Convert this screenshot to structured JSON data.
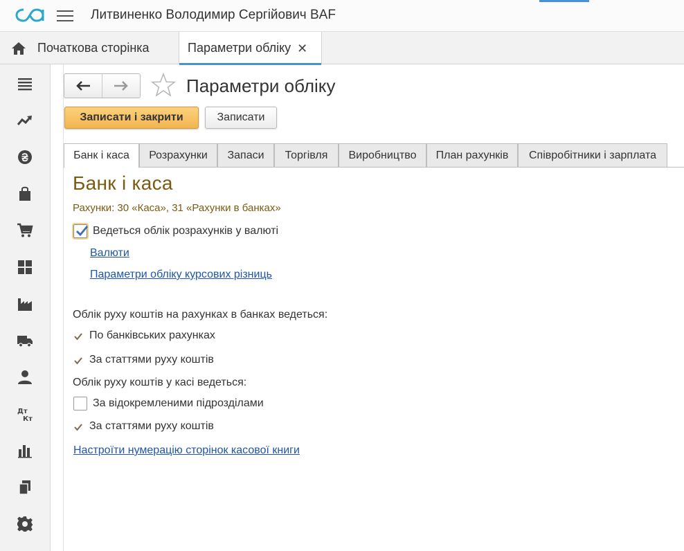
{
  "header": {
    "app_title": "Литвиненко Володимир Сергійович BAF",
    "logo_icon": "baf-logo-icon",
    "menu_icon": "hamburger-icon",
    "accent_color": "#4a90d9"
  },
  "tabs": {
    "home_label": "Початкова сторінка",
    "active_label": "Параметри обліку",
    "close_glyph": "✕"
  },
  "sidebar": {
    "items": [
      {
        "name": "main-menu",
        "icon": "list-icon"
      },
      {
        "name": "sales-dashboard",
        "icon": "trend-icon"
      },
      {
        "name": "bank-cash",
        "icon": "hryvnia-coin-icon"
      },
      {
        "name": "purchases",
        "icon": "shopping-bag-icon"
      },
      {
        "name": "sales",
        "icon": "cart-icon"
      },
      {
        "name": "warehouse",
        "icon": "boxes-icon"
      },
      {
        "name": "production",
        "icon": "factory-icon"
      },
      {
        "name": "fixed-assets",
        "icon": "truck-icon"
      },
      {
        "name": "hr-salary",
        "icon": "person-icon"
      },
      {
        "name": "accounting",
        "icon": "debit-credit-icon"
      },
      {
        "name": "reports",
        "icon": "bar-chart-icon"
      },
      {
        "name": "reference-books",
        "icon": "documents-icon"
      },
      {
        "name": "administration",
        "icon": "gear-icon"
      }
    ]
  },
  "form": {
    "title": "Параметри обліку",
    "back_icon": "arrow-left-icon",
    "forward_icon": "arrow-right-icon",
    "star_icon": "star-outline-icon",
    "save_close_label": "Записати і закрити",
    "save_label": "Записати",
    "tabs": [
      "Банк і каса",
      "Розрахунки",
      "Запаси",
      "Торгівля",
      "Виробництво",
      "План рахунків",
      "Співробітники і зарплата"
    ],
    "active_tab_index": 0
  },
  "bank": {
    "section_title": "Банк і каса",
    "accounts_note": "Рахунки: 30 «Каса», 31 «Рахунки в банках»",
    "currency_label": "Ведеться облік розрахунків у валюті",
    "currency_checked": true,
    "currencies_link": "Валюти",
    "exchange_link": "Параметри обліку курсових різниць",
    "bank_group_title": "Облік руху коштів на рахунках в банках ведеться:",
    "bank_by_accounts": "По банківських рахунках",
    "bank_by_items": "За статтями руху коштів",
    "cash_group_title": "Облік руху коштів у касі ведеться:",
    "cash_by_divisions": "За відокремленими підрозділами",
    "cash_by_divisions_checked": false,
    "cash_by_items": "За статтями руху коштів",
    "cashbook_link": "Настроїти нумерацію сторінок касової книги",
    "heading_color": "#7a5c10",
    "link_color": "#1f56a8"
  }
}
